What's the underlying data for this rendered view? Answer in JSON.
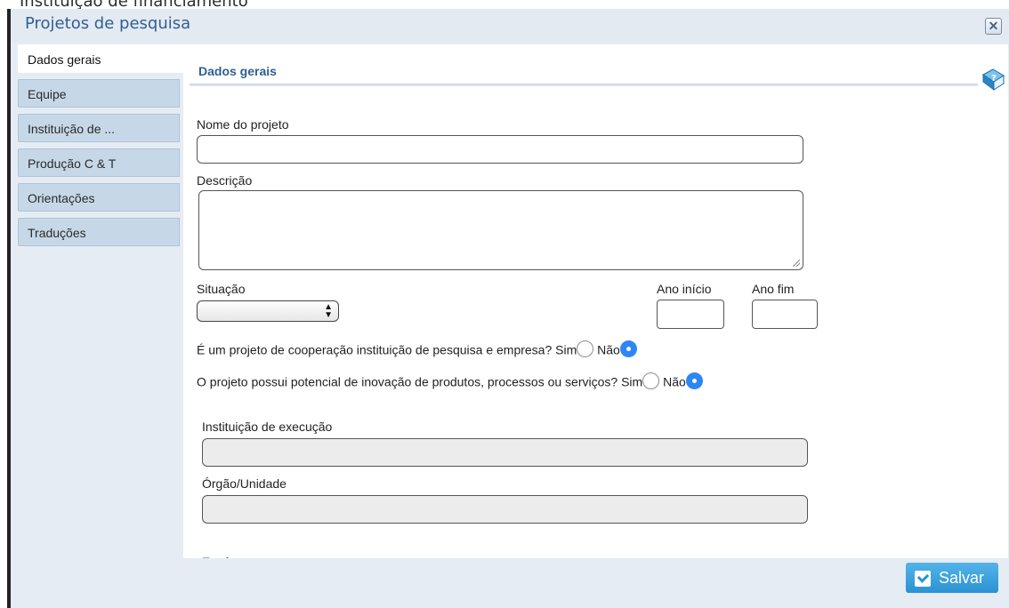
{
  "background_window_title": "Instituição de financiamento",
  "window": {
    "title": "Projetos de pesquisa",
    "close_icon": "close-icon"
  },
  "tabs": [
    {
      "label": "Dados gerais",
      "active": true
    },
    {
      "label": "Equipe",
      "active": false
    },
    {
      "label": "Instituição de ...",
      "active": false
    },
    {
      "label": "Produção C & T",
      "active": false
    },
    {
      "label": "Orientações",
      "active": false
    },
    {
      "label": "Traduções",
      "active": false
    }
  ],
  "section": {
    "title": "Dados gerais",
    "help_icon": "help-book-icon"
  },
  "form": {
    "nome_label": "Nome do projeto",
    "nome_value": "",
    "descricao_label": "Descrição",
    "descricao_value": "",
    "situacao_label": "Situação",
    "situacao_value": "",
    "ano_inicio_label": "Ano início",
    "ano_inicio_value": "",
    "ano_fim_label": "Ano fim",
    "ano_fim_value": "",
    "q1": {
      "text": "É um projeto de cooperação instituição de pesquisa e empresa?",
      "sim_label": "Sim",
      "nao_label": "Não",
      "selected": "Não"
    },
    "q2": {
      "text": "O projeto possui potencial de inovação de produtos, processos ou serviços?",
      "sim_label": "Sim",
      "nao_label": "Não",
      "selected": "Não"
    },
    "instituicao_label": "Instituição de execução",
    "instituicao_value": "",
    "orgao_label": "Órgão/Unidade",
    "orgao_value": ""
  },
  "next_section_partial": "Equipe",
  "buttons": {
    "save_label": "Salvar"
  },
  "colors": {
    "accent_blue": "#2f5f93",
    "tab_bg": "#c6d8e8",
    "radio_selected": "#2d86f4",
    "save_button": "#2b92d2"
  }
}
